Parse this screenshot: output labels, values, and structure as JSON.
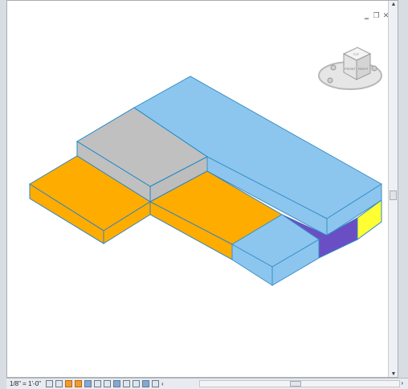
{
  "window": {
    "minimize_label": "‗",
    "restore_label": "❐",
    "close_label": "✕"
  },
  "viewcube": {
    "top_label": "TOP",
    "front_label": "FRONT",
    "right_label": "RIGHT"
  },
  "status_bar": {
    "scale_label": "1/8\" = 1'-0\"",
    "more_label": "‹",
    "right_arrow": "›"
  },
  "colors": {
    "blue": "#8cc6ee",
    "blue_edge": "#3d8fc8",
    "gray": "#c0c0c0",
    "orange": "#ffac00",
    "purple": "#6a4fc4",
    "yellow": "#ffff33"
  },
  "icons": [
    "detail-level-icon",
    "visual-style-icon",
    "sun-path-icon",
    "shadows-icon",
    "render-icon",
    "crop-view-icon",
    "show-crop-icon",
    "lock-3d-icon",
    "temporary-hide-icon",
    "reveal-hidden-icon",
    "design-options-icon",
    "analytical-model-icon"
  ]
}
